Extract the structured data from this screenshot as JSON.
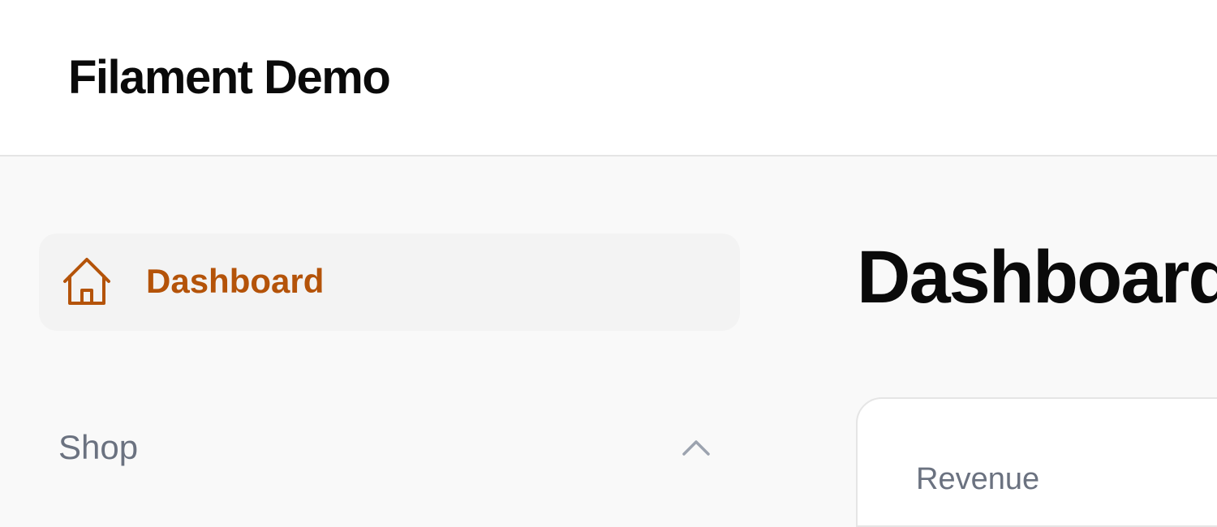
{
  "app": {
    "title": "Filament Demo"
  },
  "sidebar": {
    "items": [
      {
        "label": "Dashboard",
        "icon": "home-icon",
        "active": true
      }
    ],
    "groups": [
      {
        "label": "Shop",
        "icon": "chevron-up-icon",
        "expanded": true
      }
    ]
  },
  "main": {
    "page_title": "Dashboard",
    "widgets": [
      {
        "label": "Revenue"
      }
    ]
  },
  "colors": {
    "accent": "#b45309",
    "muted_text": "#6b7280",
    "active_bg": "#f3f3f3",
    "background": "#f9f9f9"
  }
}
